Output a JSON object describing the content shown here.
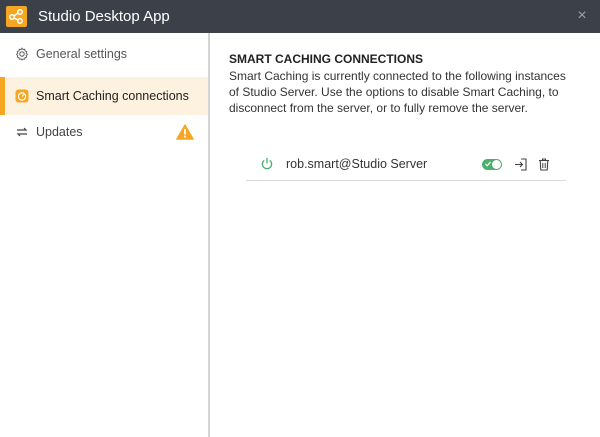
{
  "window": {
    "title": "Studio Desktop App",
    "close_glyph": "×",
    "logo_icon": "app-logo-icon",
    "titlebar_color": "#3c4049",
    "accent_color": "#f5a623"
  },
  "sidebar": {
    "items": [
      {
        "label": "General settings",
        "icon": "gear-icon",
        "active": false
      },
      {
        "label": "Smart Caching connections",
        "icon": "gauge-icon",
        "active": true
      },
      {
        "label": "Updates",
        "icon": "sync-icon",
        "active": false,
        "badge": "warning-icon"
      }
    ]
  },
  "main": {
    "heading": "SMART CACHING CONNECTIONS",
    "description": "Smart Caching is currently connected to the following instances of Studio Server. Use the options to disable Smart Caching, to disconnect from the server, or to fully remove the server.",
    "connections": [
      {
        "name": "rob.smart@Studio Server",
        "status_icon": "power-icon",
        "enabled": true,
        "status_color": "#4caf6e"
      }
    ]
  }
}
